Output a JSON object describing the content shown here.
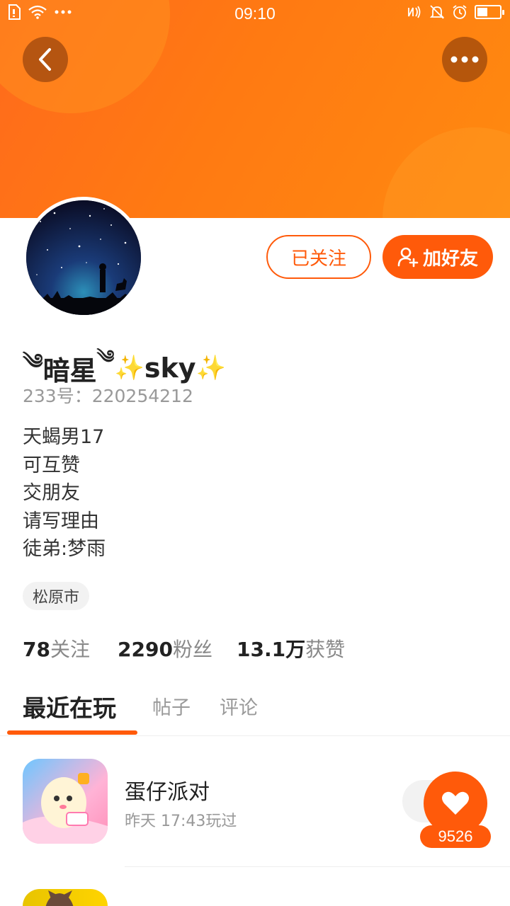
{
  "status_bar": {
    "time": "09:10",
    "left_icons": [
      "sim-icon",
      "wifi-icon",
      "more-dots-icon"
    ],
    "right_icons": [
      "nfc-icon",
      "mute-icon",
      "alarm-icon",
      "battery-icon"
    ],
    "battery_level": 0.45
  },
  "header": {
    "back_icon": "chevron-left-icon",
    "more_icon": "more-horizontal-icon",
    "colors": {
      "banner": "#ff7a12",
      "accent": "#ff5a0a"
    }
  },
  "profile": {
    "name_prefix": "༄",
    "name_main": "暗星",
    "name_suffix_mark": "༄",
    "sparkle": "✨",
    "name_latin": "sky",
    "uid_label": "233号：",
    "uid": "220254212",
    "bio": [
      "天蝎男17",
      "可互赞",
      "交朋友",
      "请写理由",
      "徒弟:梦雨"
    ],
    "city": "松原市"
  },
  "actions": {
    "followed_label": "已关注",
    "add_friend_label": "加好友"
  },
  "stats": [
    {
      "value": "78",
      "label": "关注"
    },
    {
      "value": "2290",
      "label": "粉丝"
    },
    {
      "value": "13.1万",
      "label": "获赞"
    }
  ],
  "tabs": [
    {
      "label": "最近在玩",
      "active": true
    },
    {
      "label": "帖子",
      "active": false
    },
    {
      "label": "评论",
      "active": false
    }
  ],
  "games": [
    {
      "name": "蛋仔派对",
      "time": "昨天 17:43玩过"
    }
  ],
  "favorite": {
    "count": "9526"
  }
}
